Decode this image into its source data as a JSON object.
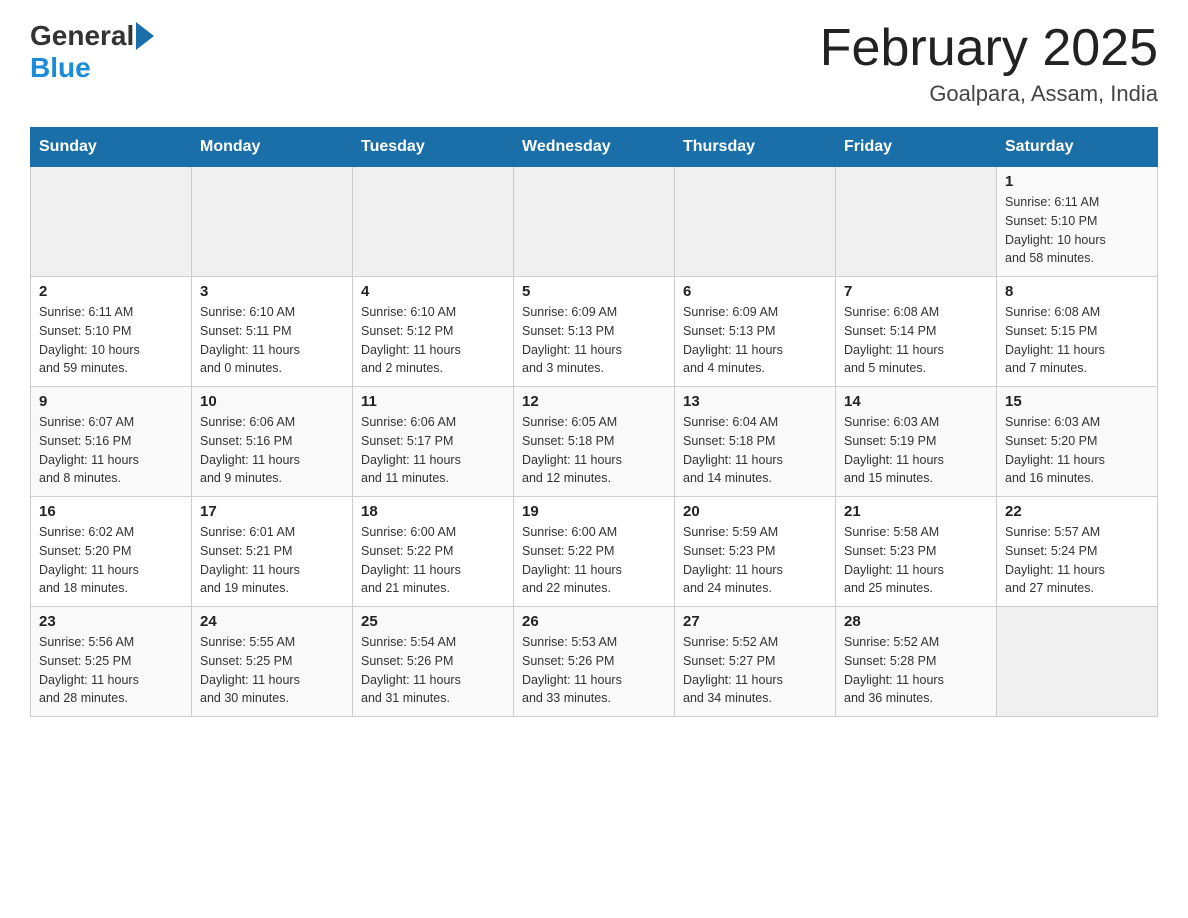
{
  "header": {
    "logo_general": "General",
    "logo_blue": "Blue",
    "title": "February 2025",
    "subtitle": "Goalpara, Assam, India"
  },
  "days_of_week": [
    "Sunday",
    "Monday",
    "Tuesday",
    "Wednesday",
    "Thursday",
    "Friday",
    "Saturday"
  ],
  "weeks": [
    [
      {
        "day": "",
        "info": ""
      },
      {
        "day": "",
        "info": ""
      },
      {
        "day": "",
        "info": ""
      },
      {
        "day": "",
        "info": ""
      },
      {
        "day": "",
        "info": ""
      },
      {
        "day": "",
        "info": ""
      },
      {
        "day": "1",
        "info": "Sunrise: 6:11 AM\nSunset: 5:10 PM\nDaylight: 10 hours\nand 58 minutes."
      }
    ],
    [
      {
        "day": "2",
        "info": "Sunrise: 6:11 AM\nSunset: 5:10 PM\nDaylight: 10 hours\nand 59 minutes."
      },
      {
        "day": "3",
        "info": "Sunrise: 6:10 AM\nSunset: 5:11 PM\nDaylight: 11 hours\nand 0 minutes."
      },
      {
        "day": "4",
        "info": "Sunrise: 6:10 AM\nSunset: 5:12 PM\nDaylight: 11 hours\nand 2 minutes."
      },
      {
        "day": "5",
        "info": "Sunrise: 6:09 AM\nSunset: 5:13 PM\nDaylight: 11 hours\nand 3 minutes."
      },
      {
        "day": "6",
        "info": "Sunrise: 6:09 AM\nSunset: 5:13 PM\nDaylight: 11 hours\nand 4 minutes."
      },
      {
        "day": "7",
        "info": "Sunrise: 6:08 AM\nSunset: 5:14 PM\nDaylight: 11 hours\nand 5 minutes."
      },
      {
        "day": "8",
        "info": "Sunrise: 6:08 AM\nSunset: 5:15 PM\nDaylight: 11 hours\nand 7 minutes."
      }
    ],
    [
      {
        "day": "9",
        "info": "Sunrise: 6:07 AM\nSunset: 5:16 PM\nDaylight: 11 hours\nand 8 minutes."
      },
      {
        "day": "10",
        "info": "Sunrise: 6:06 AM\nSunset: 5:16 PM\nDaylight: 11 hours\nand 9 minutes."
      },
      {
        "day": "11",
        "info": "Sunrise: 6:06 AM\nSunset: 5:17 PM\nDaylight: 11 hours\nand 11 minutes."
      },
      {
        "day": "12",
        "info": "Sunrise: 6:05 AM\nSunset: 5:18 PM\nDaylight: 11 hours\nand 12 minutes."
      },
      {
        "day": "13",
        "info": "Sunrise: 6:04 AM\nSunset: 5:18 PM\nDaylight: 11 hours\nand 14 minutes."
      },
      {
        "day": "14",
        "info": "Sunrise: 6:03 AM\nSunset: 5:19 PM\nDaylight: 11 hours\nand 15 minutes."
      },
      {
        "day": "15",
        "info": "Sunrise: 6:03 AM\nSunset: 5:20 PM\nDaylight: 11 hours\nand 16 minutes."
      }
    ],
    [
      {
        "day": "16",
        "info": "Sunrise: 6:02 AM\nSunset: 5:20 PM\nDaylight: 11 hours\nand 18 minutes."
      },
      {
        "day": "17",
        "info": "Sunrise: 6:01 AM\nSunset: 5:21 PM\nDaylight: 11 hours\nand 19 minutes."
      },
      {
        "day": "18",
        "info": "Sunrise: 6:00 AM\nSunset: 5:22 PM\nDaylight: 11 hours\nand 21 minutes."
      },
      {
        "day": "19",
        "info": "Sunrise: 6:00 AM\nSunset: 5:22 PM\nDaylight: 11 hours\nand 22 minutes."
      },
      {
        "day": "20",
        "info": "Sunrise: 5:59 AM\nSunset: 5:23 PM\nDaylight: 11 hours\nand 24 minutes."
      },
      {
        "day": "21",
        "info": "Sunrise: 5:58 AM\nSunset: 5:23 PM\nDaylight: 11 hours\nand 25 minutes."
      },
      {
        "day": "22",
        "info": "Sunrise: 5:57 AM\nSunset: 5:24 PM\nDaylight: 11 hours\nand 27 minutes."
      }
    ],
    [
      {
        "day": "23",
        "info": "Sunrise: 5:56 AM\nSunset: 5:25 PM\nDaylight: 11 hours\nand 28 minutes."
      },
      {
        "day": "24",
        "info": "Sunrise: 5:55 AM\nSunset: 5:25 PM\nDaylight: 11 hours\nand 30 minutes."
      },
      {
        "day": "25",
        "info": "Sunrise: 5:54 AM\nSunset: 5:26 PM\nDaylight: 11 hours\nand 31 minutes."
      },
      {
        "day": "26",
        "info": "Sunrise: 5:53 AM\nSunset: 5:26 PM\nDaylight: 11 hours\nand 33 minutes."
      },
      {
        "day": "27",
        "info": "Sunrise: 5:52 AM\nSunset: 5:27 PM\nDaylight: 11 hours\nand 34 minutes."
      },
      {
        "day": "28",
        "info": "Sunrise: 5:52 AM\nSunset: 5:28 PM\nDaylight: 11 hours\nand 36 minutes."
      },
      {
        "day": "",
        "info": ""
      }
    ]
  ]
}
